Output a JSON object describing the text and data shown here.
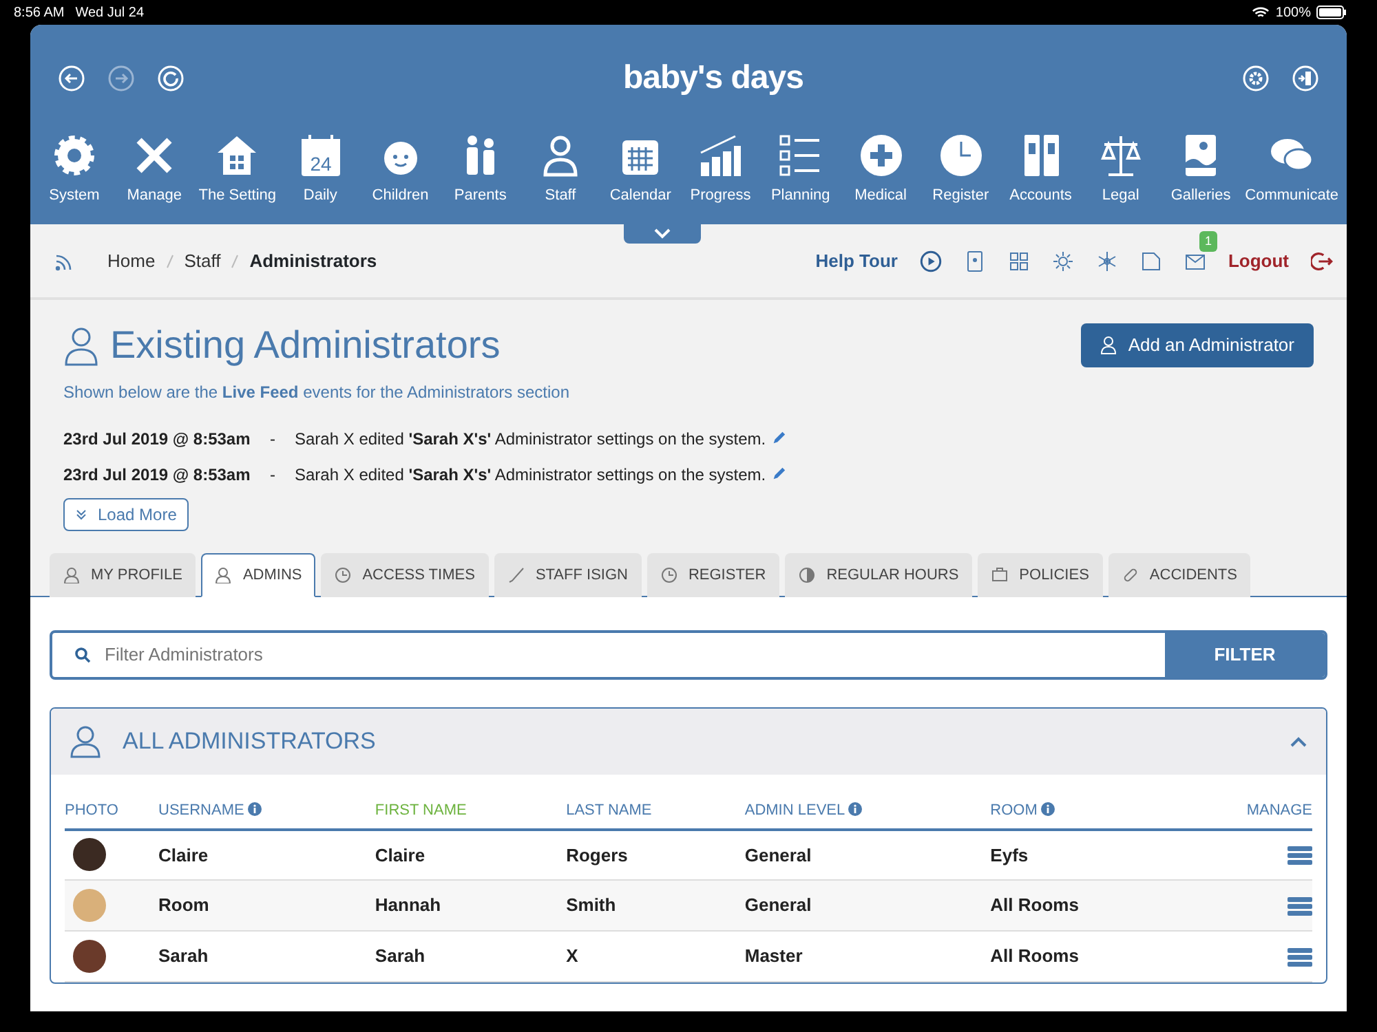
{
  "status_bar": {
    "time": "8:56 AM",
    "date": "Wed Jul 24",
    "battery": "100%"
  },
  "header": {
    "logo": "baby's days",
    "modules": [
      {
        "label": "System"
      },
      {
        "label": "Manage"
      },
      {
        "label": "The Setting"
      },
      {
        "label": "Daily",
        "icon_text": "24"
      },
      {
        "label": "Children"
      },
      {
        "label": "Parents"
      },
      {
        "label": "Staff"
      },
      {
        "label": "Calendar"
      },
      {
        "label": "Progress"
      },
      {
        "label": "Planning"
      },
      {
        "label": "Medical"
      },
      {
        "label": "Register"
      },
      {
        "label": "Accounts"
      },
      {
        "label": "Legal"
      },
      {
        "label": "Galleries"
      },
      {
        "label": "Communicate"
      }
    ]
  },
  "breadcrumb": {
    "items": [
      {
        "label": "Home",
        "current": false
      },
      {
        "label": "Staff",
        "current": false
      },
      {
        "label": "Administrators",
        "current": true
      }
    ],
    "help_tour": "Help Tour",
    "notification_count": "1",
    "logout": "Logout"
  },
  "page": {
    "title": "Existing Administrators",
    "add_button": "Add an Administrator",
    "intro": "Shown below are the **Live Feed** events for the Administrators section",
    "feed": [
      {
        "time": "23rd Jul 2019 @ 8:53am",
        "separator": "-",
        "text": "Sarah X edited **'Sarah X's'** Administrator settings on the system."
      },
      {
        "time": "23rd Jul 2019 @ 8:53am",
        "separator": "-",
        "text": "Sarah X edited **'Sarah X's'** Administrator settings on the system."
      }
    ],
    "load_more": "Load More"
  },
  "tabs": [
    {
      "label": "MY PROFILE",
      "selected": false
    },
    {
      "label": "ADMINS",
      "selected": true
    },
    {
      "label": "ACCESS TIMES",
      "selected": false
    },
    {
      "label": "STAFF ISIGN",
      "selected": false
    },
    {
      "label": "REGISTER",
      "selected": false
    },
    {
      "label": "REGULAR HOURS",
      "selected": false
    },
    {
      "label": "POLICIES",
      "selected": false
    },
    {
      "label": "ACCIDENTS",
      "selected": false
    }
  ],
  "filter": {
    "placeholder": "Filter Administrators",
    "button": "FILTER"
  },
  "panel": {
    "title": "ALL ADMINISTRATORS",
    "expanded": true,
    "table": {
      "columns": [
        {
          "label": "PHOTO",
          "info": false,
          "sorted": false
        },
        {
          "label": "USERNAME",
          "info": true,
          "sorted": false
        },
        {
          "label": "FIRST NAME",
          "info": false,
          "sorted": true
        },
        {
          "label": "LAST NAME",
          "info": false,
          "sorted": false
        },
        {
          "label": "ADMIN LEVEL",
          "info": true,
          "sorted": false
        },
        {
          "label": "ROOM",
          "info": true,
          "sorted": false
        },
        {
          "label": "MANAGE",
          "info": false,
          "sorted": false
        }
      ],
      "rows": [
        {
          "username": "Claire",
          "first_name": "Claire",
          "last_name": "Rogers",
          "admin_level": "General",
          "room": "Eyfs"
        },
        {
          "username": "Room",
          "first_name": "Hannah",
          "last_name": "Smith",
          "admin_level": "General",
          "room": "All Rooms"
        },
        {
          "username": "Sarah",
          "first_name": "Sarah",
          "last_name": "X",
          "admin_level": "Master",
          "room": "All Rooms"
        }
      ]
    }
  }
}
